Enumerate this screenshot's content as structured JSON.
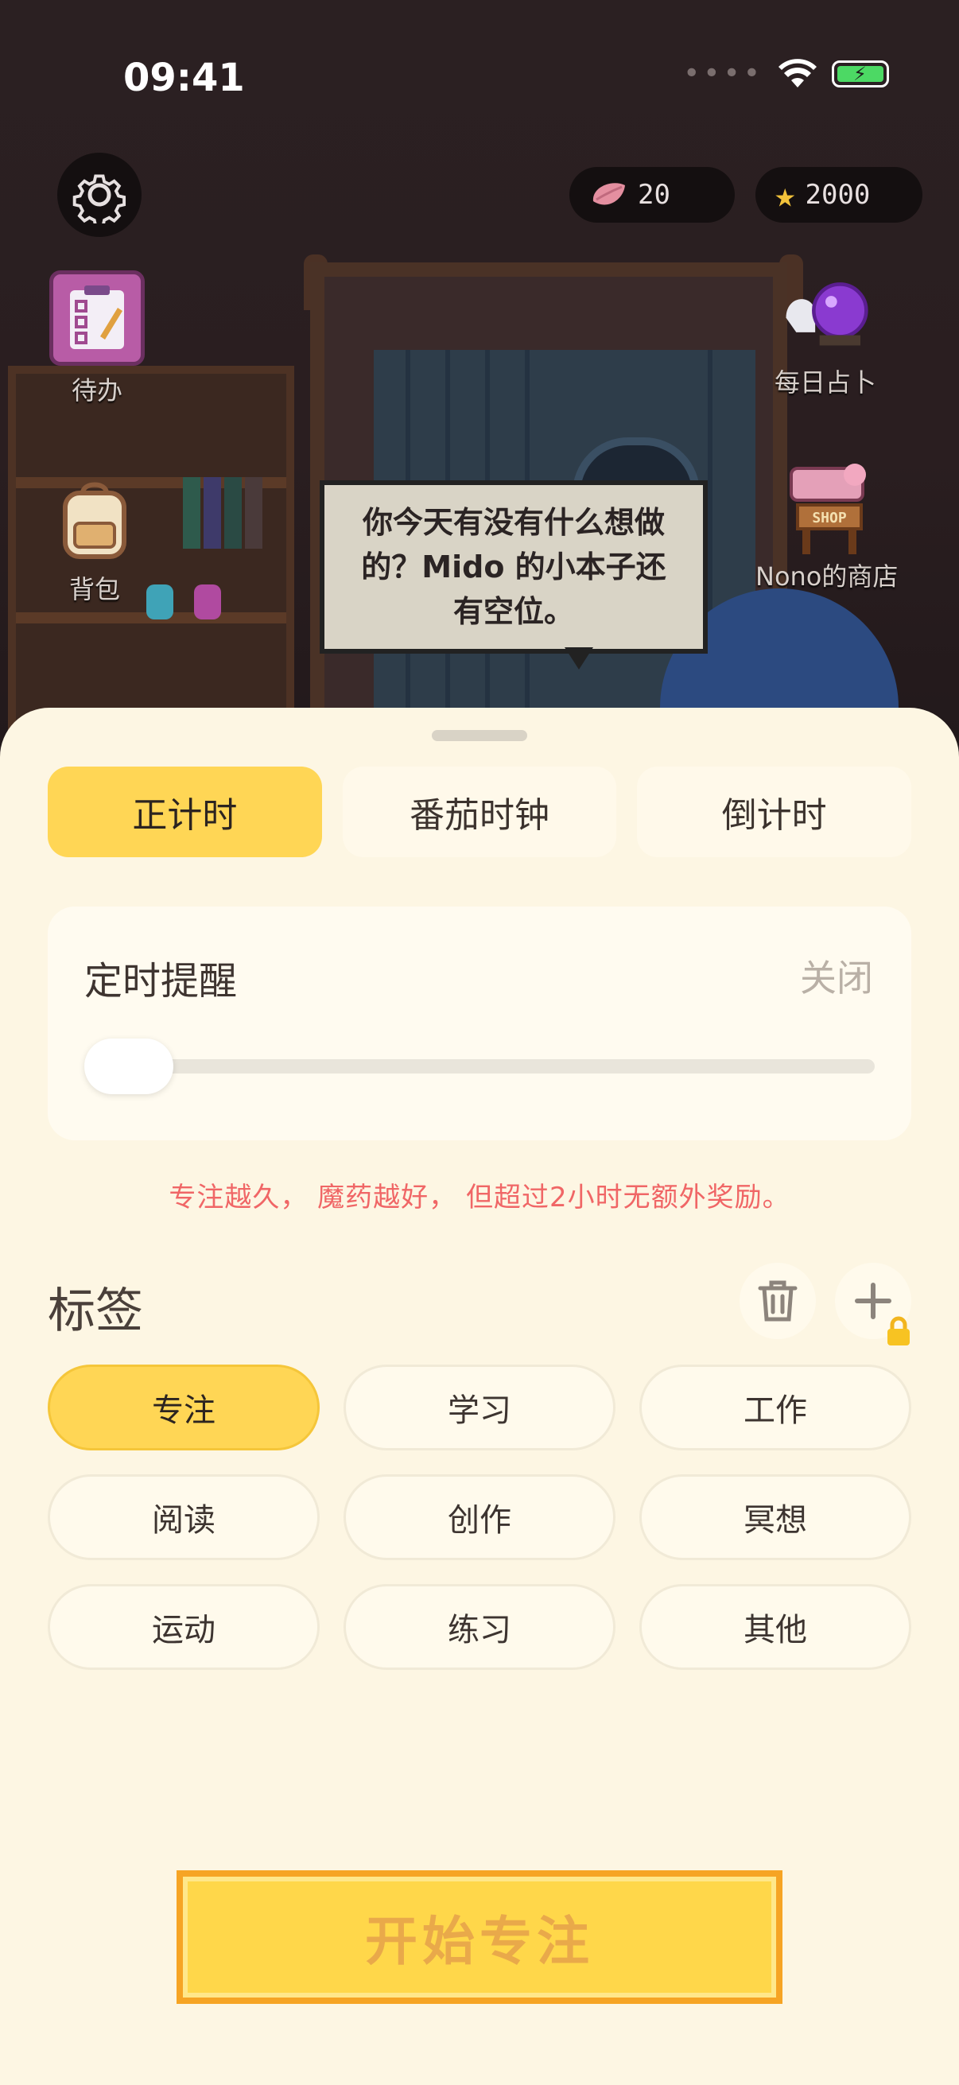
{
  "status_bar": {
    "time": "09:41"
  },
  "top_bar": {
    "petals": "20",
    "stars": "2000"
  },
  "scene": {
    "todo_label": "待办",
    "backpack_label": "背包",
    "fortune_label": "每日占卜",
    "shop_label": "Nono的商店",
    "shop_sign": "SHOP",
    "speech_bubble": "你今天有没有什么想做的？Mido 的小本子还有空位。"
  },
  "mode_tabs": [
    {
      "label": "正计时",
      "active": true
    },
    {
      "label": "番茄时钟",
      "active": false
    },
    {
      "label": "倒计时",
      "active": false
    }
  ],
  "reminder": {
    "title": "定时提醒",
    "state": "关闭",
    "slider_value": 0
  },
  "hint": "专注越久， 魔药越好， 但超过2小时无额外奖励。",
  "tags": {
    "title": "标签",
    "items": [
      {
        "label": "专注",
        "active": true
      },
      {
        "label": "学习",
        "active": false
      },
      {
        "label": "工作",
        "active": false
      },
      {
        "label": "阅读",
        "active": false
      },
      {
        "label": "创作",
        "active": false
      },
      {
        "label": "冥想",
        "active": false
      },
      {
        "label": "运动",
        "active": false
      },
      {
        "label": "练习",
        "active": false
      },
      {
        "label": "其他",
        "active": false
      }
    ]
  },
  "start_button": "开始专注",
  "colors": {
    "accent": "#ffd655",
    "sheet_bg": "#fdf6e3",
    "hint": "#f06666",
    "scene_bg": "#2a1f22"
  }
}
